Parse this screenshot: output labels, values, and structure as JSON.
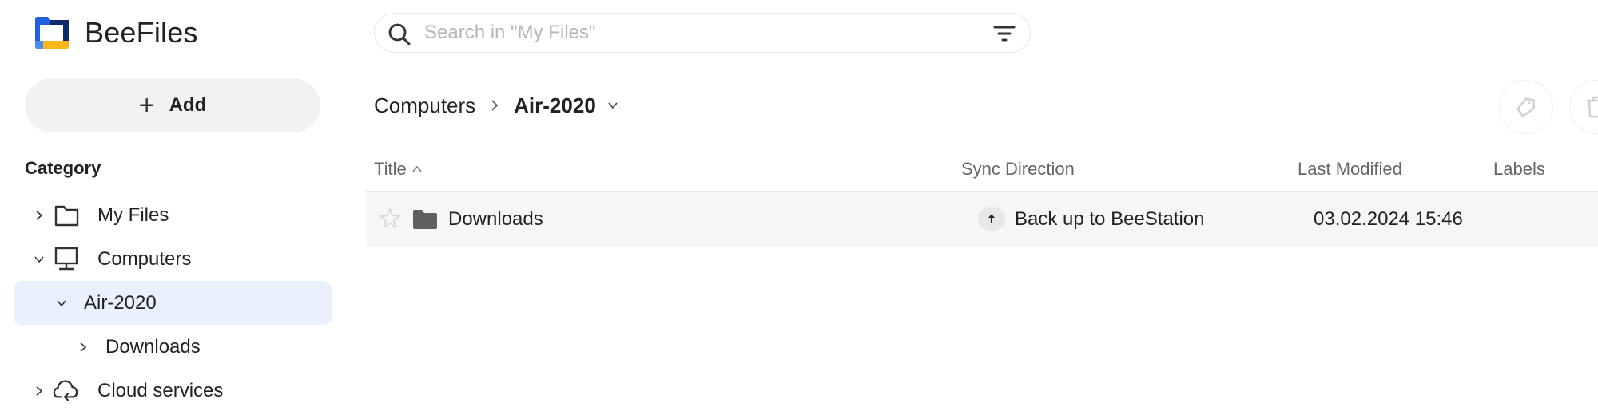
{
  "app": {
    "name": "BeeFiles",
    "brand_colors": {
      "blue": "#1f5fe0",
      "navy": "#0a2a6b",
      "yellow": "#fbb619",
      "light_blue": "#4a8af4"
    }
  },
  "sidebar": {
    "add_label": "Add",
    "category_title": "Category",
    "items": [
      {
        "label": "My Files",
        "icon": "folder-outline-icon",
        "expanded": false
      },
      {
        "label": "Computers",
        "icon": "monitor-icon",
        "expanded": true
      },
      {
        "label": "Air-2020",
        "expanded": true,
        "selected": true
      },
      {
        "label": "Downloads",
        "expanded": false
      },
      {
        "label": "Cloud services",
        "icon": "cloud-sync-icon",
        "expanded": false
      }
    ],
    "selected_color": "#e9f1fd"
  },
  "search": {
    "placeholder": "Search in \"My Files\"",
    "value": ""
  },
  "breadcrumb": {
    "items": [
      "Computers",
      "Air-2020"
    ]
  },
  "table": {
    "columns": [
      "Title",
      "Sync Direction",
      "Last Modified",
      "Labels"
    ],
    "sort": {
      "column": "Title",
      "direction": "ascending"
    },
    "rows": [
      {
        "title": "Downloads",
        "starred": false,
        "type": "folder",
        "sync_direction": "Back up to BeeStation",
        "last_modified": "03.02.2024 15:46",
        "labels": ""
      }
    ]
  }
}
